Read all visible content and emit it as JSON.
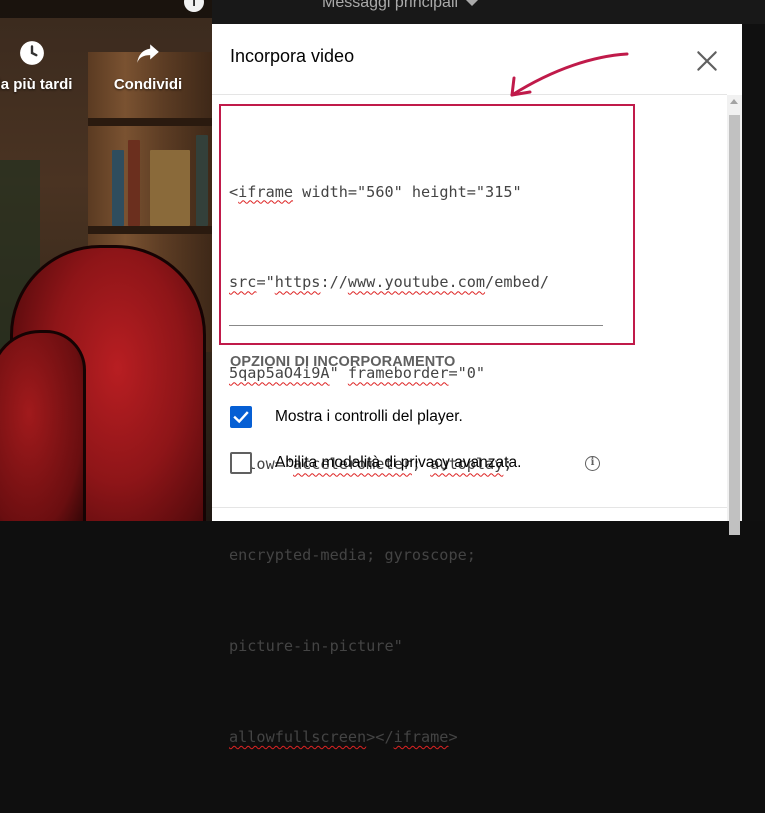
{
  "page": {
    "top_text": "Messaggi principali"
  },
  "video_overlay": {
    "watch_later_label": "da più tardi",
    "share_label": "Condividi"
  },
  "dialog": {
    "title": "Incorpora video",
    "close_icon": "close-icon",
    "code_lines": [
      "<iframe width=\"560\" height=\"315\"",
      "src=\"https://www.youtube.com/embed/",
      "5qap5aO4i9A\" frameborder=\"0\"",
      "allow=\"accelerometer; autoplay;",
      "encrypted-media; gyroscope;",
      "picture-in-picture\"",
      "allowfullscreen></iframe>"
    ],
    "section_title": "OPZIONI DI INCORPORAMENTO",
    "options": [
      {
        "label": "Mostra i controlli del player.",
        "checked": true
      },
      {
        "label": "Abilita modalità di privacy avanzata.",
        "checked": false
      }
    ]
  },
  "colors": {
    "accent": "#065fd4",
    "annotation": "#c01a4a"
  }
}
